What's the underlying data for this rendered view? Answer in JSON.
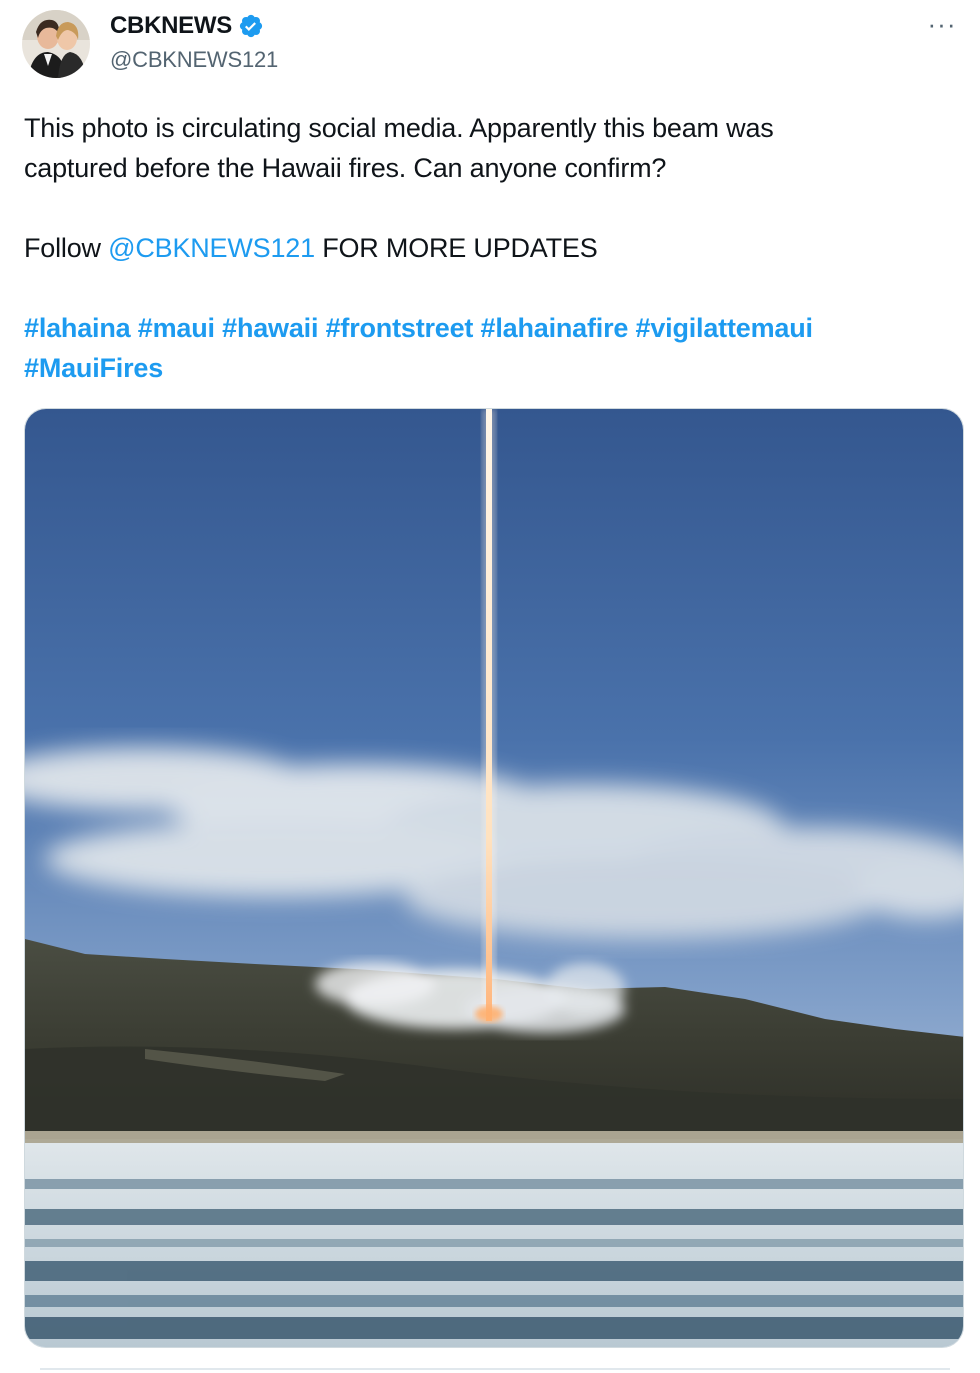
{
  "author": {
    "display_name": "CBKNEWS",
    "handle": "@CBKNEWS121",
    "verified": true,
    "avatar_icon": "avatar-photo"
  },
  "menu": {
    "more_label": "···"
  },
  "tweet": {
    "line1": "This photo is circulating social media. Apparently this beam was",
    "line2": "captured before the Hawaii fires. Can anyone confirm?",
    "follow_prefix": "Follow ",
    "follow_mention": "@CBKNEWS121",
    "follow_suffix": " FOR MORE UPDATES",
    "hashtags": [
      "#lahaina",
      "#maui",
      "#hawaii",
      "#frontstreet",
      "#lahainafire",
      "#vigilattemaui",
      "#MauiFires"
    ]
  },
  "colors": {
    "link": "#1d9bf0",
    "verified": "#1d9bf0",
    "text": "#0f1419",
    "secondary": "#536471"
  }
}
